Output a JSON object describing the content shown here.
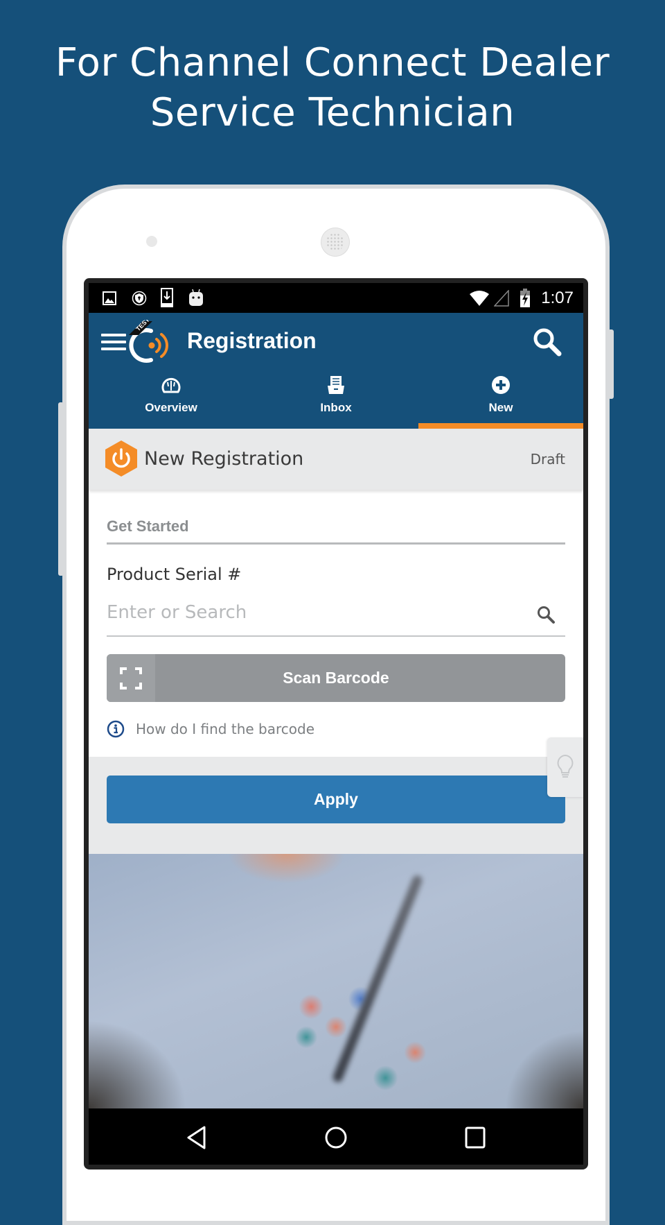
{
  "promo": {
    "headline_line1": "For Channel Connect Dealer",
    "headline_line2": "Service Technician"
  },
  "status_bar": {
    "left_icons": [
      "image-icon",
      "shield-key-icon",
      "download-icon",
      "android-icon"
    ],
    "right_icons": [
      "wifi-icon",
      "cell-signal-icon",
      "battery-charging-icon"
    ],
    "time": "1:07"
  },
  "app_bar": {
    "logo_badge": "TEST",
    "title": "Registration",
    "menu_icon": "hamburger-icon",
    "search_icon": "search-icon"
  },
  "tabs": [
    {
      "label": "Overview",
      "icon": "gauge-icon",
      "active": false
    },
    {
      "label": "Inbox",
      "icon": "inbox-tray-icon",
      "active": false
    },
    {
      "label": "New",
      "icon": "plus-circle-icon",
      "active": true
    }
  ],
  "card": {
    "title": "New Registration",
    "status": "Draft"
  },
  "form": {
    "section_title": "Get Started",
    "serial_label": "Product Serial #",
    "serial_value": "",
    "serial_placeholder": "Enter or Search",
    "scan_button": "Scan Barcode",
    "help_link": "How do I find the barcode",
    "apply_button": "Apply"
  },
  "colors": {
    "brand_blue": "#15507a",
    "accent_orange": "#f48c27",
    "apply_blue": "#2d79b3",
    "scan_gray": "#929598"
  }
}
